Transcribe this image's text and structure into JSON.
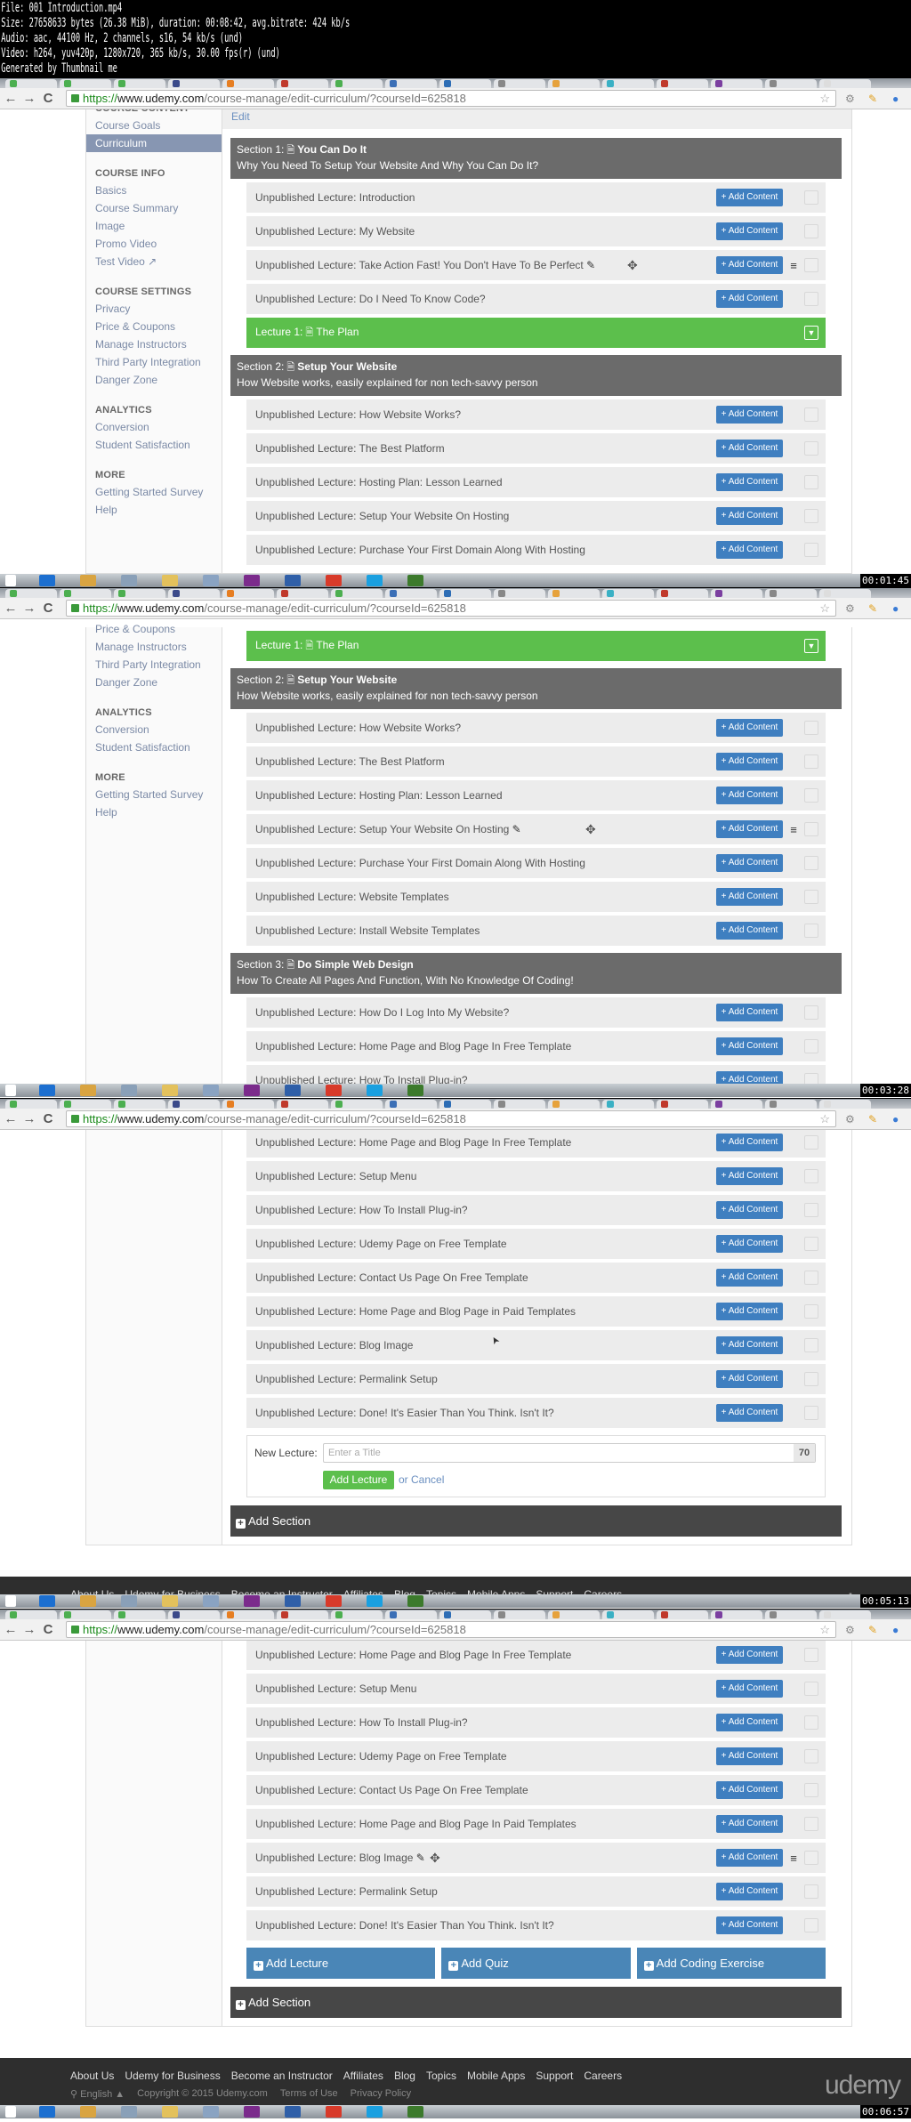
{
  "video_info": [
    "File: 001 Introduction.mp4",
    "Size: 27658633 bytes (26.38 MiB), duration: 00:08:42, avg.bitrate: 424 kb/s",
    "Audio: aac, 44100 Hz, 2 channels, s16, 54 kb/s (und)",
    "Video: h264, yuv420p, 1280x720, 365 kb/s, 30.00 fps(r) (und)",
    "Generated by Thumbnail me"
  ],
  "browser": {
    "url_scheme": "https://",
    "url_host": "www.udemy.com",
    "url_path": "/course-manage/edit-curriculum/?courseId=625818"
  },
  "sidebar": {
    "groups": [
      {
        "title": "COURSE CONTENT",
        "items": [
          {
            "label": "Course Goals"
          },
          {
            "label": "Curriculum",
            "active": true
          }
        ]
      },
      {
        "title": "COURSE INFO",
        "items": [
          {
            "label": "Basics"
          },
          {
            "label": "Course Summary"
          },
          {
            "label": "Image"
          },
          {
            "label": "Promo Video"
          },
          {
            "label": "Test Video ↗"
          }
        ]
      },
      {
        "title": "COURSE SETTINGS",
        "items": [
          {
            "label": "Privacy"
          },
          {
            "label": "Price & Coupons"
          },
          {
            "label": "Manage Instructors"
          },
          {
            "label": "Third Party Integration"
          },
          {
            "label": "Danger Zone"
          }
        ]
      },
      {
        "title": "ANALYTICS",
        "items": [
          {
            "label": "Conversion"
          },
          {
            "label": "Student Satisfaction"
          }
        ]
      },
      {
        "title": "MORE",
        "items": [
          {
            "label": "Getting Started Survey"
          },
          {
            "label": "Help"
          }
        ]
      }
    ]
  },
  "course_header": {
    "edit_label": "Edit"
  },
  "add_content_label": "+ Add Content",
  "frames": [
    {
      "timestamp": "00:01:45",
      "show_sidebar": true,
      "items": [
        {
          "type": "header"
        },
        {
          "type": "section",
          "prefix": "Section 1:",
          "title": "You Can Do It",
          "subtitle": "Why You Need To Setup Your Website And Why You Can Do It?"
        },
        {
          "type": "lecture",
          "text": "Unpublished Lecture: Introduction"
        },
        {
          "type": "lecture",
          "text": "Unpublished Lecture: My Website"
        },
        {
          "type": "lecture",
          "text": "Unpublished Lecture: Take Action Fast! You Don't Have To Be Perfect",
          "hover": true
        },
        {
          "type": "lecture",
          "text": "Unpublished Lecture: Do I Need To Know Code?"
        },
        {
          "type": "published",
          "prefix": "Lecture 1:",
          "title": "The Plan"
        },
        {
          "type": "section",
          "prefix": "Section 2:",
          "title": "Setup Your Website",
          "subtitle": "How Website works, easily explained for non tech-savvy person"
        },
        {
          "type": "lecture",
          "text": "Unpublished Lecture: How Website Works?"
        },
        {
          "type": "lecture",
          "text": "Unpublished Lecture: The Best Platform"
        },
        {
          "type": "lecture",
          "text": "Unpublished Lecture: Hosting Plan: Lesson Learned"
        },
        {
          "type": "lecture",
          "text": "Unpublished Lecture: Setup Your Website On Hosting"
        },
        {
          "type": "lecture",
          "text": "Unpublished Lecture: Purchase Your First Domain Along With Hosting"
        }
      ]
    },
    {
      "timestamp": "00:03:28",
      "show_sidebar": true,
      "items": [
        {
          "type": "published",
          "prefix": "Lecture 1:",
          "title": "The Plan"
        },
        {
          "type": "section",
          "prefix": "Section 2:",
          "title": "Setup Your Website",
          "subtitle": "How Website works, easily explained for non tech-savvy person"
        },
        {
          "type": "lecture",
          "text": "Unpublished Lecture: How Website Works?"
        },
        {
          "type": "lecture",
          "text": "Unpublished Lecture: The Best Platform"
        },
        {
          "type": "lecture",
          "text": "Unpublished Lecture: Hosting Plan: Lesson Learned"
        },
        {
          "type": "lecture",
          "text": "Unpublished Lecture: Setup Your Website On Hosting",
          "hover": true
        },
        {
          "type": "lecture",
          "text": "Unpublished Lecture: Purchase Your First Domain Along With Hosting"
        },
        {
          "type": "lecture",
          "text": "Unpublished Lecture: Website Templates"
        },
        {
          "type": "lecture",
          "text": "Unpublished Lecture: Install Website Templates"
        },
        {
          "type": "section",
          "prefix": "Section 3:",
          "title": "Do Simple Web Design",
          "subtitle": "How To Create All Pages And Function, With No Knowledge Of Coding!"
        },
        {
          "type": "lecture",
          "text": "Unpublished Lecture: How Do I Log Into My Website?"
        },
        {
          "type": "lecture",
          "text": "Unpublished Lecture: Home Page and Blog Page In Free Template"
        },
        {
          "type": "lecture",
          "text": "Unpublished Lecture: How To Install Plug-in?"
        }
      ]
    },
    {
      "timestamp": "00:05:13",
      "show_sidebar": false,
      "items": [
        {
          "type": "lecture",
          "text": "Unpublished Lecture: Home Page and Blog Page In Free Template"
        },
        {
          "type": "lecture",
          "text": "Unpublished Lecture: Setup Menu"
        },
        {
          "type": "lecture",
          "text": "Unpublished Lecture: How To Install Plug-in?"
        },
        {
          "type": "lecture",
          "text": "Unpublished Lecture: Udemy Page on Free Template"
        },
        {
          "type": "lecture",
          "text": "Unpublished Lecture: Contact Us Page On Free Template"
        },
        {
          "type": "lecture",
          "text": "Unpublished Lecture: Home Page and Blog Page in Paid Templates"
        },
        {
          "type": "lecture",
          "text": "Unpublished Lecture: Blog Image"
        },
        {
          "type": "lecture",
          "text": "Unpublished Lecture: Permalink Setup"
        },
        {
          "type": "lecture",
          "text": "Unpublished Lecture: Done! It's Easier Than You Think. Isn't It?"
        },
        {
          "type": "form",
          "label": "New Lecture:",
          "placeholder": "Enter a Title",
          "count": "70",
          "add_label": "Add Lecture",
          "or_label": "or",
          "cancel_label": "Cancel"
        },
        {
          "type": "addsection",
          "label": "Add Section"
        },
        {
          "type": "footer"
        }
      ]
    },
    {
      "timestamp": "00:06:57",
      "show_sidebar": false,
      "items": [
        {
          "type": "lecture",
          "text": "Unpublished Lecture: Home Page and Blog Page In Free Template"
        },
        {
          "type": "lecture",
          "text": "Unpublished Lecture: Setup Menu"
        },
        {
          "type": "lecture",
          "text": "Unpublished Lecture: How To Install Plug-in?"
        },
        {
          "type": "lecture",
          "text": "Unpublished Lecture: Udemy Page on Free Template"
        },
        {
          "type": "lecture",
          "text": "Unpublished Lecture: Contact Us Page On Free Template"
        },
        {
          "type": "lecture",
          "text": "Unpublished Lecture: Home Page and Blog Page In Paid Templates"
        },
        {
          "type": "lecture",
          "text": "Unpublished Lecture: Blog Image",
          "hover": true
        },
        {
          "type": "lecture",
          "text": "Unpublished Lecture: Permalink Setup"
        },
        {
          "type": "lecture",
          "text": "Unpublished Lecture: Done! It's Easier Than You Think. Isn't It?"
        },
        {
          "type": "addbuttons",
          "labels": [
            "Add Lecture",
            "Add Quiz",
            "Add Coding Exercise"
          ]
        },
        {
          "type": "addsection",
          "label": "Add Section"
        },
        {
          "type": "footer"
        }
      ]
    }
  ],
  "footer": {
    "links": [
      "About Us",
      "Udemy for Business",
      "Become an Instructor",
      "Affiliates",
      "Blog",
      "Topics",
      "Mobile Apps",
      "Support",
      "Careers"
    ],
    "language": "English ▲",
    "copyright": "Copyright © 2015 Udemy.com",
    "terms": "Terms of Use",
    "privacy": "Privacy Policy",
    "logo": "udemy"
  },
  "colors": {
    "section_header": "#6b6b6b",
    "published_lecture": "#5cbf4c",
    "add_content_button": "#3f7fc0",
    "add_section": "#474747",
    "sidebar_active": "#8796b2"
  }
}
